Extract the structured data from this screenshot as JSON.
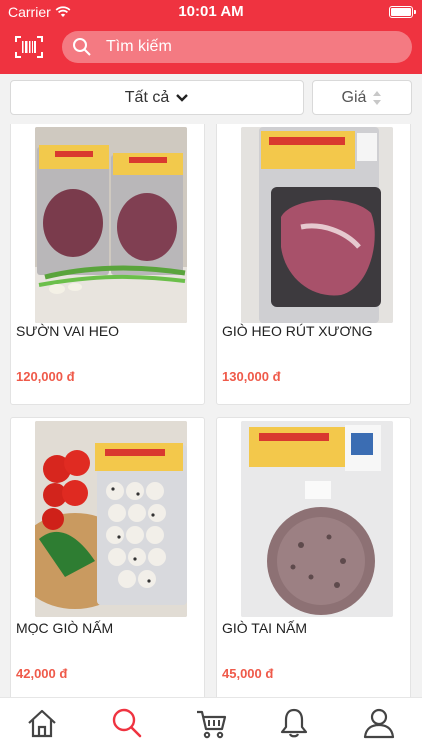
{
  "status": {
    "carrier": "Carrier",
    "time": "10:01 AM"
  },
  "header": {
    "search_placeholder": "Tìm kiếm",
    "accent": "#ef3340"
  },
  "filters": {
    "category_label": "Tất cả",
    "sort_label": "Giá"
  },
  "products": [
    {
      "name": "SƯỜN VAI HEO",
      "price": "120,000 đ"
    },
    {
      "name": "GIÒ HEO RÚT XƯƠNG",
      "price": "130,000 đ"
    },
    {
      "name": "MỌC GIÒ NẤM",
      "price": "42,000 đ"
    },
    {
      "name": "GIÒ TAI NẤM",
      "price": "45,000 đ"
    }
  ],
  "product_images": [
    "meat-package-icon",
    "pork-package-icon",
    "meatball-package-icon",
    "ham-package-icon"
  ],
  "nav": [
    "home-icon",
    "search-icon",
    "cart-icon",
    "bell-icon",
    "user-icon"
  ],
  "price_color": "#ef5a4a"
}
